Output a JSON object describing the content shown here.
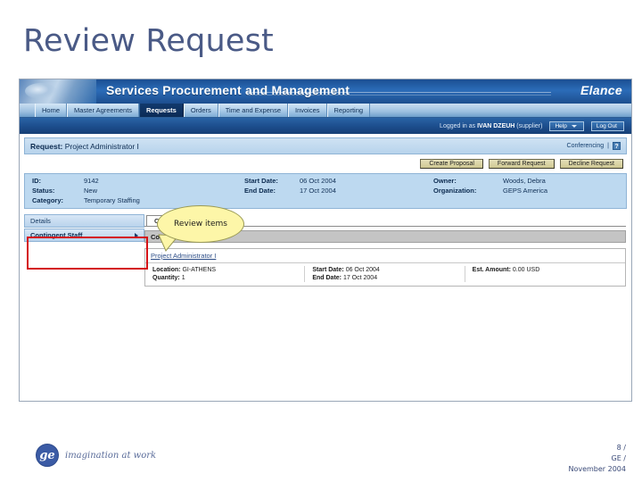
{
  "slide": {
    "title": "Review Request"
  },
  "app": {
    "banner_title": "Services Procurement and Management",
    "logo": "Elance",
    "tabs": [
      {
        "label": "Home",
        "active": false
      },
      {
        "label": "Master Agreements",
        "active": false
      },
      {
        "label": "Requests",
        "active": true
      },
      {
        "label": "Orders",
        "active": false
      },
      {
        "label": "Time and Expense",
        "active": false
      },
      {
        "label": "Invoices",
        "active": false
      },
      {
        "label": "Reporting",
        "active": false
      }
    ],
    "login": {
      "prefix": "Logged in as ",
      "user": "IVAN DZEUH",
      "suffix": " (supplier)",
      "help_label": "Help",
      "logout_label": "Log Out"
    }
  },
  "request": {
    "heading_label": "Request:",
    "heading_value": "Project Administrator I",
    "conferencing_label": "Conferencing",
    "separator": "|",
    "help_glyph": "?",
    "buttons": [
      {
        "label": "Create Proposal"
      },
      {
        "label": "Forward Request"
      },
      {
        "label": "Decline Request"
      }
    ],
    "fields": [
      {
        "label": "ID:",
        "value": "9142"
      },
      {
        "label": "Start Date:",
        "value": "06 Oct 2004"
      },
      {
        "label": "Owner:",
        "value": "Woods, Debra"
      },
      {
        "label": "Status:",
        "value": "New"
      },
      {
        "label": "End Date:",
        "value": "17 Oct 2004"
      },
      {
        "label": "Organization:",
        "value": "GEPS America"
      },
      {
        "label": "Category:",
        "value": "Temporary Staffing"
      },
      {
        "label": "",
        "value": ""
      },
      {
        "label": "",
        "value": ""
      }
    ]
  },
  "sidebar": {
    "items": [
      {
        "label": "Details",
        "has_arrow": false
      },
      {
        "label": "Contingent Staff",
        "has_arrow": true
      }
    ]
  },
  "content": {
    "tab_label": "Contingent Staff",
    "section_title": "Contingent Staff",
    "item": {
      "link": "Project Administrator I",
      "rows": [
        {
          "label": "Location:",
          "value": "GI-ATHENS"
        },
        {
          "label": "Quantity:",
          "value": "1"
        },
        {
          "label": "Start Date:",
          "value": "06 Oct 2004"
        },
        {
          "label": "End Date:",
          "value": "17 Oct 2004"
        },
        {
          "label": "Est. Amount:",
          "value": "0.00 USD"
        }
      ]
    }
  },
  "callout": {
    "text": "Review items"
  },
  "footer": {
    "ge_mark": "ge",
    "tagline": "imagination at work",
    "page_number": "8 /",
    "org": "GE /",
    "date": "November 2004"
  },
  "colors": {
    "title": "#4a5a86",
    "banner_dark": "#1b4f92",
    "accent_red": "#d41216",
    "callout_yellow": "#fdf6a8",
    "info_blue": "#bdd9f0",
    "button_khaki": "#e4dfb8"
  }
}
